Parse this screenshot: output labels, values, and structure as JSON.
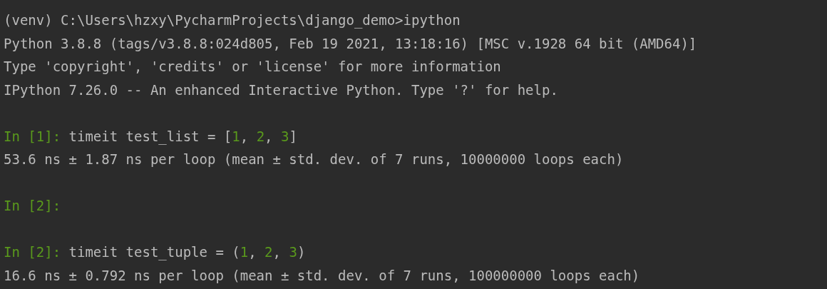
{
  "terminal": {
    "lines": [
      {
        "kind": "text",
        "segments": [
          {
            "kind": "plain",
            "text": "(venv) C:\\Users\\hzxy\\PycharmProjects\\django_demo>ipython"
          }
        ]
      },
      {
        "kind": "text",
        "segments": [
          {
            "kind": "plain",
            "text": "Python 3.8.8 (tags/v3.8.8:024d805, Feb 19 2021, 13:18:16) [MSC v.1928 64 bit (AMD64)]"
          }
        ]
      },
      {
        "kind": "text",
        "segments": [
          {
            "kind": "plain",
            "text": "Type 'copyright', 'credits' or 'license' for more information"
          }
        ]
      },
      {
        "kind": "text",
        "segments": [
          {
            "kind": "plain",
            "text": "IPython 7.26.0 -- An enhanced Interactive Python. Type '?' for help."
          }
        ]
      },
      {
        "kind": "blank"
      },
      {
        "kind": "text",
        "segments": [
          {
            "kind": "prompt",
            "text": "In [1]: "
          },
          {
            "kind": "plain",
            "text": "timeit test_list = ["
          },
          {
            "kind": "number",
            "text": "1"
          },
          {
            "kind": "plain",
            "text": ", "
          },
          {
            "kind": "number",
            "text": "2"
          },
          {
            "kind": "plain",
            "text": ", "
          },
          {
            "kind": "number",
            "text": "3"
          },
          {
            "kind": "plain",
            "text": "]"
          }
        ]
      },
      {
        "kind": "text",
        "segments": [
          {
            "kind": "plain",
            "text": "53.6 ns ± 1.87 ns per loop (mean ± std. dev. of 7 runs, 10000000 loops each)"
          }
        ]
      },
      {
        "kind": "blank"
      },
      {
        "kind": "text",
        "segments": [
          {
            "kind": "prompt",
            "text": "In [2]:"
          }
        ]
      },
      {
        "kind": "blank"
      },
      {
        "kind": "text",
        "segments": [
          {
            "kind": "prompt",
            "text": "In [2]: "
          },
          {
            "kind": "plain",
            "text": "timeit test_tuple = ("
          },
          {
            "kind": "number",
            "text": "1"
          },
          {
            "kind": "plain",
            "text": ", "
          },
          {
            "kind": "number",
            "text": "2"
          },
          {
            "kind": "plain",
            "text": ", "
          },
          {
            "kind": "number",
            "text": "3"
          },
          {
            "kind": "plain",
            "text": ")"
          }
        ]
      },
      {
        "kind": "text",
        "segments": [
          {
            "kind": "plain",
            "text": "16.6 ns ± 0.792 ns per loop (mean ± std. dev. of 7 runs, 100000000 loops each)"
          }
        ]
      }
    ]
  }
}
